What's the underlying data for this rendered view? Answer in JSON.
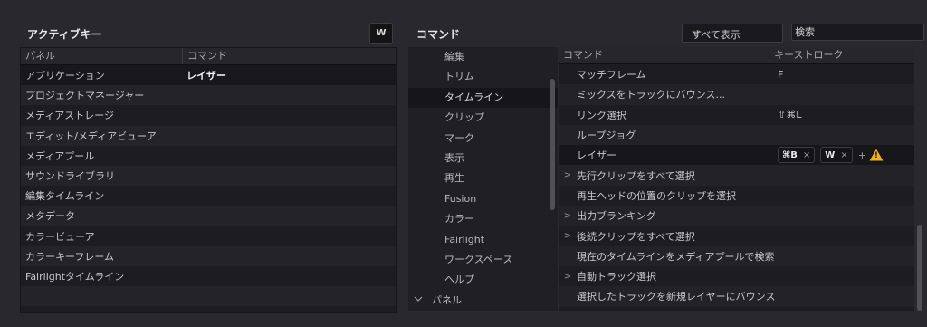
{
  "active_keys": {
    "title": "アクティブキー",
    "key_button": "W",
    "columns": [
      "パネル",
      "コマンド"
    ],
    "rows": [
      {
        "panel": "アプリケーション",
        "command": "レイザー"
      },
      {
        "panel": "プロジェクトマネージャー",
        "command": ""
      },
      {
        "panel": "メディアストレージ",
        "command": ""
      },
      {
        "panel": "エディット/メディアビューア",
        "command": ""
      },
      {
        "panel": "メディアプール",
        "command": ""
      },
      {
        "panel": "サウンドライブラリ",
        "command": ""
      },
      {
        "panel": "編集タイムライン",
        "command": ""
      },
      {
        "panel": "メタデータ",
        "command": ""
      },
      {
        "panel": "カラービューア",
        "command": ""
      },
      {
        "panel": "カラーキーフレーム",
        "command": ""
      },
      {
        "panel": "Fairlightタイムライン",
        "command": ""
      },
      {
        "panel": "",
        "command": ""
      },
      {
        "panel": "",
        "command": ""
      }
    ]
  },
  "commands": {
    "title": "コマンド",
    "filter_label": "すべて表示",
    "search_placeholder": "検索",
    "categories": [
      "編集",
      "トリム",
      "タイムライン",
      "クリップ",
      "マーク",
      "表示",
      "再生",
      "Fusion",
      "カラー",
      "Fairlight",
      "ワークスペース",
      "ヘルプ",
      "パネル"
    ],
    "category_group_chevron": "v",
    "columns": [
      "コマンド",
      "キーストローク"
    ],
    "rows": [
      {
        "name": "マッチフレーム",
        "key": "F"
      },
      {
        "name": "ミックスをトラックにバウンス...",
        "key": ""
      },
      {
        "name": "リンク選択",
        "key": "⇧⌘L"
      },
      {
        "name": "ループジョグ",
        "key": ""
      },
      {
        "name": "レイザー",
        "key": ""
      },
      {
        "name": "先行クリップをすべて選択",
        "key": ""
      },
      {
        "name": "再生ヘッドの位置のクリップを選択",
        "key": ""
      },
      {
        "name": "出力ブランキング",
        "key": ""
      },
      {
        "name": "後続クリップをすべて選択",
        "key": ""
      },
      {
        "name": "現在のタイムラインをメディアプールで検索",
        "key": ""
      },
      {
        "name": "自動トラック選択",
        "key": ""
      },
      {
        "name": "選択したトラックを新規レイヤーにバウンス",
        "key": ""
      },
      {
        "name": "",
        "key": ""
      }
    ],
    "razor_keys": [
      "⌘B",
      "W"
    ],
    "chip_close": "×",
    "add_symbol": "+",
    "warning_symbol": "!",
    "expand_symbol": ">"
  },
  "colors": {
    "background": "#28282e",
    "warning": "#f2b01e"
  }
}
